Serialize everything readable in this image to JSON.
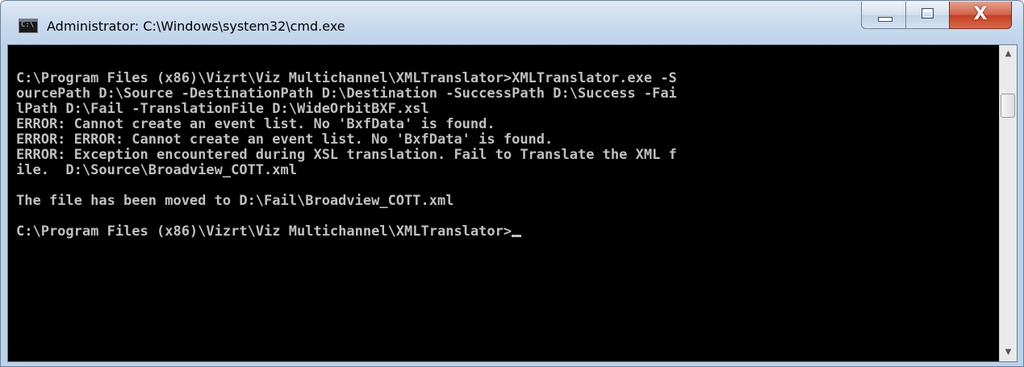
{
  "window": {
    "title": "Administrator: C:\\Windows\\system32\\cmd.exe",
    "icon": "cmd-icon",
    "icon_label": "C:\\"
  },
  "caption_buttons": {
    "minimize": "minimize-icon",
    "maximize": "maximize-icon",
    "close": "close-icon",
    "close_glyph": "X"
  },
  "console": {
    "lines": [
      "C:\\Program Files (x86)\\Vizrt\\Viz Multichannel\\XMLTranslator>XMLTranslator.exe -S",
      "ourcePath D:\\Source -DestinationPath D:\\Destination -SuccessPath D:\\Success -Fai",
      "lPath D:\\Fail -TranslationFile D:\\WideOrbitBXF.xsl",
      "ERROR: Cannot create an event list. No 'BxfData' is found.",
      "ERROR: ERROR: Cannot create an event list. No 'BxfData' is found.",
      "ERROR: Exception encountered during XSL translation. Fail to Translate the XML f",
      "ile.  D:\\Source\\Broadview_COTT.xml",
      "",
      "The file has been moved to D:\\Fail\\Broadview_COTT.xml",
      "",
      "C:\\Program Files (x86)\\Vizrt\\Viz Multichannel\\XMLTranslator>"
    ],
    "text_color": "#c0c0c0",
    "background": "#000000"
  },
  "scrollbar": {
    "up_arrow": "▲",
    "down_arrow": "▼"
  },
  "colors": {
    "titlebar": "#c9daee",
    "close_button": "#c43d22"
  }
}
